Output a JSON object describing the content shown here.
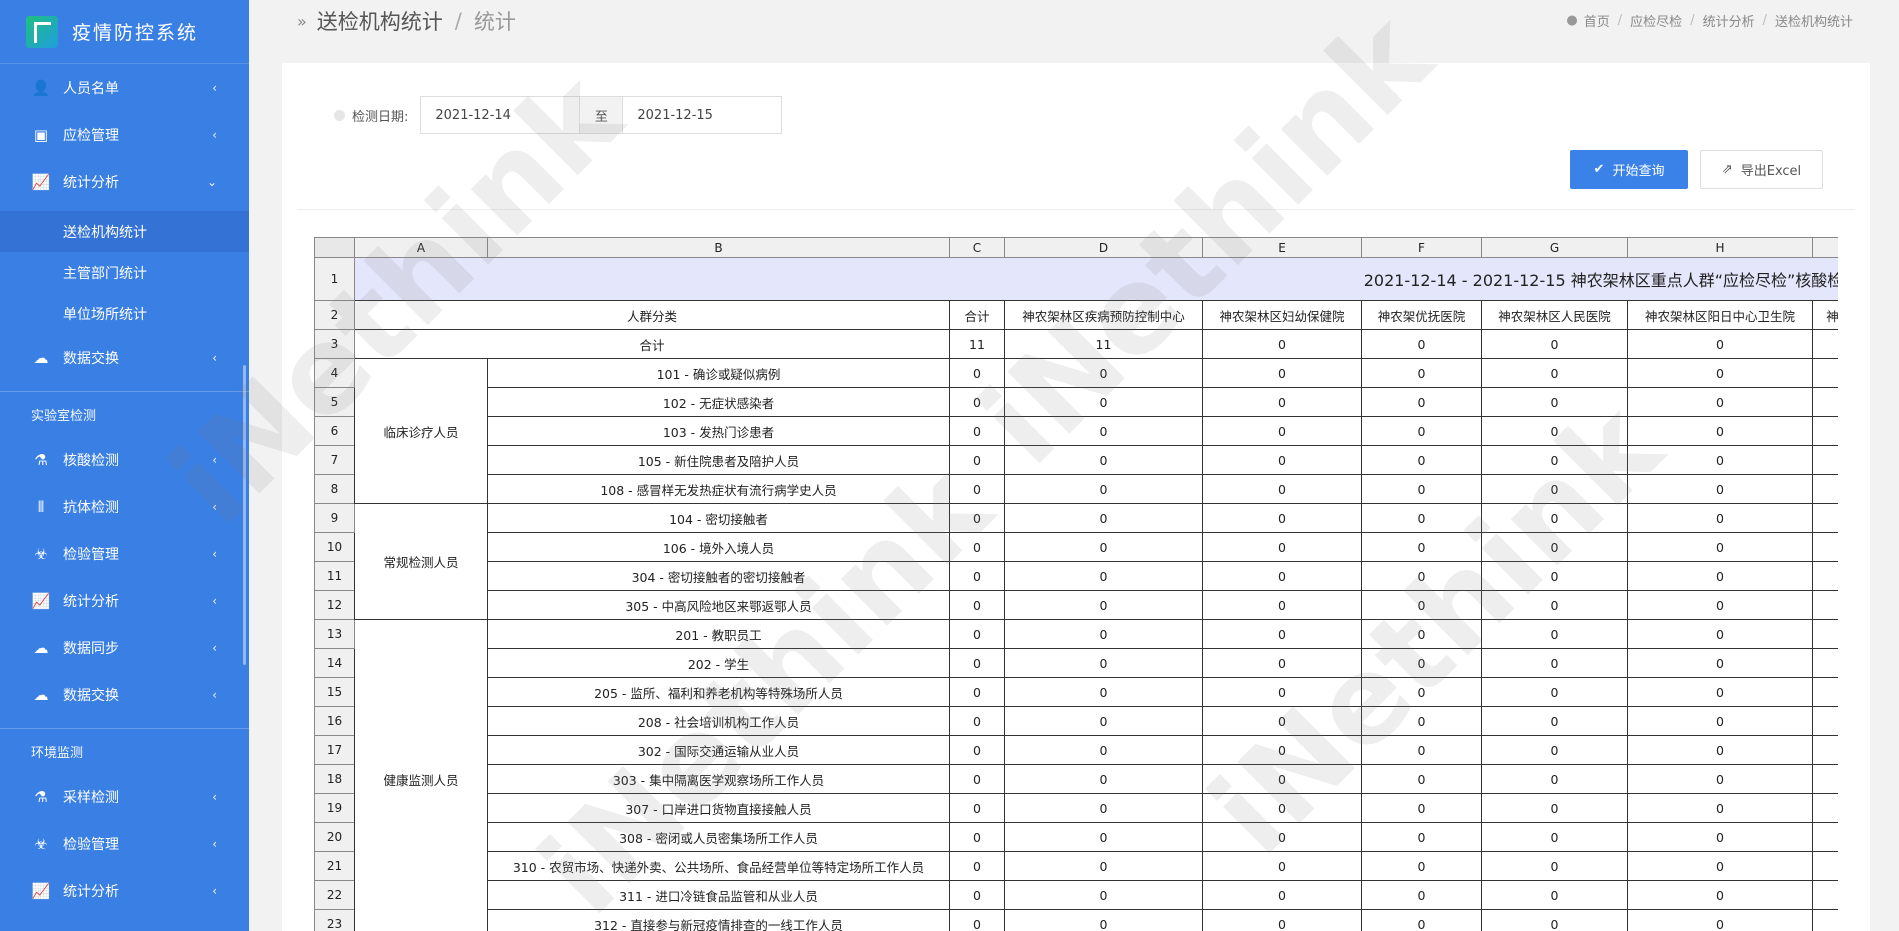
{
  "app": {
    "title": "疫情防控系统"
  },
  "sidebar": {
    "items": [
      {
        "label": "人员名单",
        "icon": "user-list-icon"
      },
      {
        "label": "应检管理",
        "icon": "clipboard-icon"
      },
      {
        "label": "统计分析",
        "icon": "chart-icon",
        "expanded": true
      }
    ],
    "sub_items": [
      {
        "label": "送检机构统计",
        "active": true
      },
      {
        "label": "主管部门统计"
      },
      {
        "label": "单位场所统计"
      }
    ],
    "items2": [
      {
        "label": "数据交换",
        "icon": "cloud-upload-icon"
      }
    ],
    "section_lab": "实验室检测",
    "lab_items": [
      {
        "label": "核酸检测",
        "icon": "flask-icon"
      },
      {
        "label": "抗体检测",
        "icon": "test-tube-icon"
      },
      {
        "label": "检验管理",
        "icon": "biohazard-icon"
      },
      {
        "label": "统计分析",
        "icon": "chart-icon"
      },
      {
        "label": "数据同步",
        "icon": "cloud-upload-icon"
      },
      {
        "label": "数据交换",
        "icon": "cloud-upload-icon"
      }
    ],
    "section_env": "环境监测",
    "env_items": [
      {
        "label": "采样检测",
        "icon": "flask-icon"
      },
      {
        "label": "检验管理",
        "icon": "biohazard-icon"
      },
      {
        "label": "统计分析",
        "icon": "chart-icon"
      }
    ]
  },
  "header": {
    "title": "送检机构统计",
    "subtitle": "统计",
    "breadcrumb": [
      "首页",
      "应检尽检",
      "统计分析",
      "送检机构统计"
    ]
  },
  "filter": {
    "label": "检测日期:",
    "start": "2021-12-14",
    "to": "至",
    "end": "2021-12-15",
    "query_button": "开始查询",
    "export_button": "导出Excel"
  },
  "sheet": {
    "col_letters": [
      "A",
      "B",
      "C",
      "D",
      "E",
      "F",
      "G",
      "H"
    ],
    "title": "2021-12-14 - 2021-12-15 神农架林区重点人群“应检尽检”核酸检",
    "header_group": "人群分类",
    "header_total": "合计",
    "header_orgs": [
      "神农架林区疾病预防控制中心",
      "神农架林区妇幼保健院",
      "神农架优抚医院",
      "神农架林区人民医院",
      "神农架林区阳日中心卫生院",
      "神"
    ],
    "total_row": {
      "label": "合计",
      "values": [
        "11",
        "11",
        "0",
        "0",
        "0",
        "0"
      ]
    },
    "groups": [
      {
        "name": "临床诊疗人员",
        "rows": [
          {
            "label": "101 - 确诊或疑似病例",
            "values": [
              "0",
              "0",
              "0",
              "0",
              "0",
              "0"
            ]
          },
          {
            "label": "102 - 无症状感染者",
            "values": [
              "0",
              "0",
              "0",
              "0",
              "0",
              "0"
            ]
          },
          {
            "label": "103 - 发热门诊患者",
            "values": [
              "0",
              "0",
              "0",
              "0",
              "0",
              "0"
            ]
          },
          {
            "label": "105 - 新住院患者及陪护人员",
            "values": [
              "0",
              "0",
              "0",
              "0",
              "0",
              "0"
            ]
          },
          {
            "label": "108 - 感冒样无发热症状有流行病学史人员",
            "values": [
              "0",
              "0",
              "0",
              "0",
              "0",
              "0"
            ]
          }
        ]
      },
      {
        "name": "常规检测人员",
        "rows": [
          {
            "label": "104 - 密切接触者",
            "values": [
              "0",
              "0",
              "0",
              "0",
              "0",
              "0"
            ]
          },
          {
            "label": "106 - 境外入境人员",
            "values": [
              "0",
              "0",
              "0",
              "0",
              "0",
              "0"
            ]
          },
          {
            "label": "304 - 密切接触者的密切接触者",
            "values": [
              "0",
              "0",
              "0",
              "0",
              "0",
              "0"
            ]
          },
          {
            "label": "305 - 中高风险地区来鄂返鄂人员",
            "values": [
              "0",
              "0",
              "0",
              "0",
              "0",
              "0"
            ]
          }
        ]
      },
      {
        "name": "健康监测人员",
        "rows": [
          {
            "label": "201 - 教职员工",
            "values": [
              "0",
              "0",
              "0",
              "0",
              "0",
              "0"
            ]
          },
          {
            "label": "202 - 学生",
            "values": [
              "0",
              "0",
              "0",
              "0",
              "0",
              "0"
            ]
          },
          {
            "label": "205 - 监所、福利和养老机构等特殊场所人员",
            "values": [
              "0",
              "0",
              "0",
              "0",
              "0",
              "0"
            ]
          },
          {
            "label": "208 - 社会培训机构工作人员",
            "values": [
              "0",
              "0",
              "0",
              "0",
              "0",
              "0"
            ]
          },
          {
            "label": "302 - 国际交通运输从业人员",
            "values": [
              "0",
              "0",
              "0",
              "0",
              "0",
              "0"
            ]
          },
          {
            "label": "303 - 集中隔离医学观察场所工作人员",
            "values": [
              "0",
              "0",
              "0",
              "0",
              "0",
              "0"
            ]
          },
          {
            "label": "307 - 口岸进口货物直接接触人员",
            "values": [
              "0",
              "0",
              "0",
              "0",
              "0",
              "0"
            ]
          },
          {
            "label": "308 - 密闭或人员密集场所工作人员",
            "values": [
              "0",
              "0",
              "0",
              "0",
              "0",
              "0"
            ]
          },
          {
            "label": "310 - 农贸市场、快递外卖、公共场所、食品经营单位等特定场所工作人员",
            "values": [
              "0",
              "0",
              "0",
              "0",
              "0",
              "0"
            ]
          },
          {
            "label": "311 - 进口冷链食品监管和从业人员",
            "values": [
              "0",
              "0",
              "0",
              "0",
              "0",
              "0"
            ]
          },
          {
            "label": "312 - 直接参与新冠疫情排查的一线工作人员",
            "values": [
              "0",
              "0",
              "0",
              "0",
              "0",
              "0"
            ]
          }
        ]
      }
    ]
  },
  "watermark": "iNethink",
  "colors": {
    "sidebar": "#3a7fe4",
    "primary_button": "#3b82e8",
    "title_row": "#e4e6fb"
  }
}
